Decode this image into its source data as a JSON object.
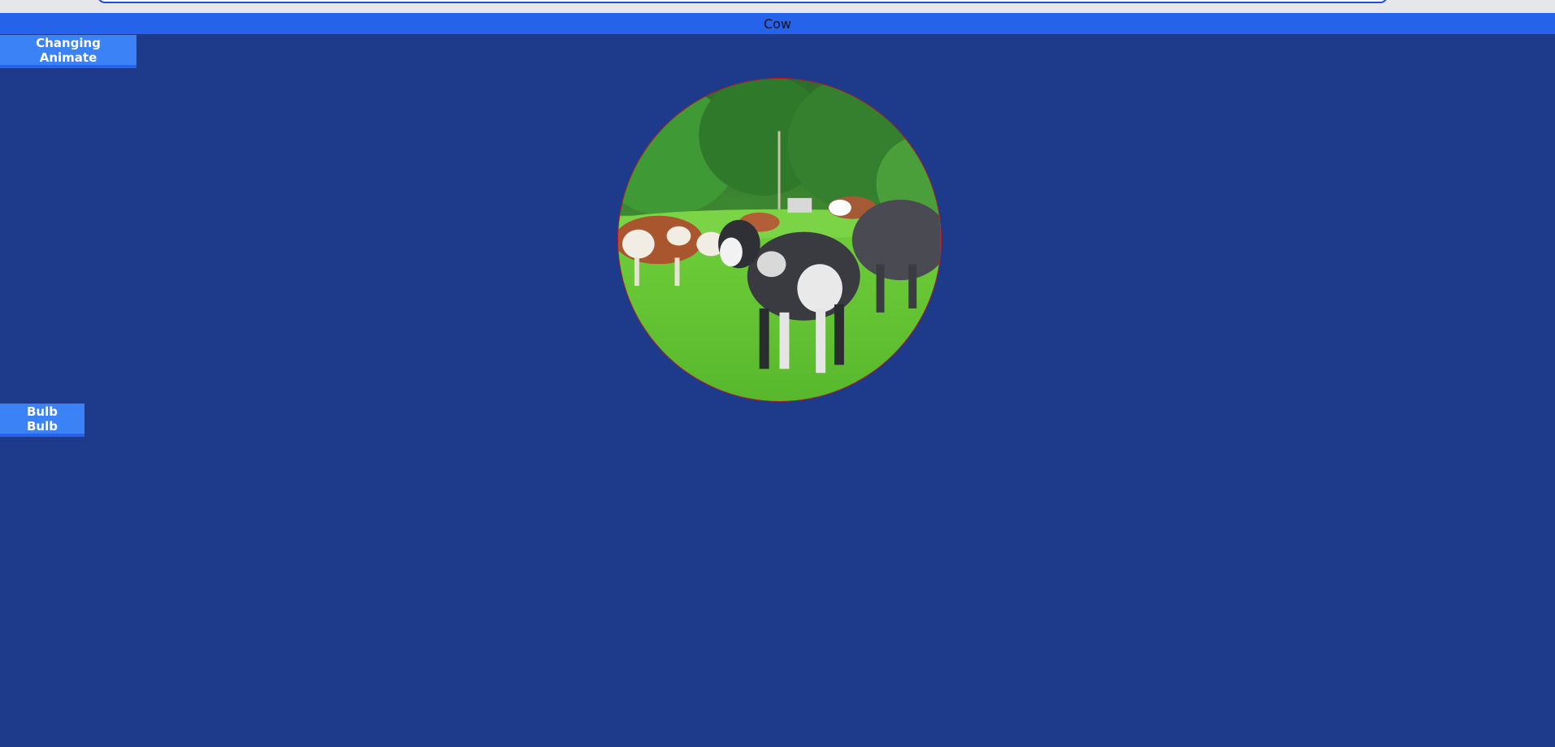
{
  "page": {
    "title": "Cow"
  },
  "buttons": {
    "animate_label": "Changing Animate",
    "bulb_label": "Bulb Bulb"
  },
  "colors": {
    "background": "#1e3a8a",
    "title_bar": "#2563eb",
    "button": "#3b82f6",
    "circle_border": "#b91c1c"
  },
  "media": {
    "subject": "cow-herd-video-frame"
  }
}
